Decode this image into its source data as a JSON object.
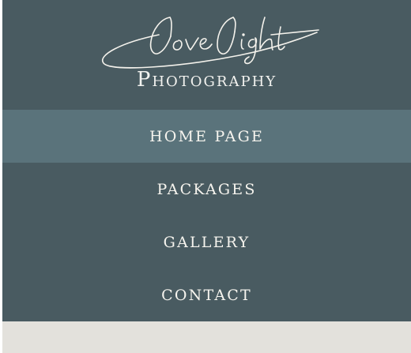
{
  "logo": {
    "script_text": "Love Light",
    "subtitle": "Photography"
  },
  "nav": {
    "items": [
      {
        "label": "HOME PAGE",
        "active": true
      },
      {
        "label": "PACKAGES",
        "active": false
      },
      {
        "label": "GALLERY",
        "active": false
      },
      {
        "label": "CONTACT",
        "active": false
      }
    ]
  },
  "colors": {
    "menu_background": "#495b61",
    "active_item_background": "#5a737b",
    "text": "#f6f4ee",
    "bottom_strip": "#e3e1dc"
  }
}
